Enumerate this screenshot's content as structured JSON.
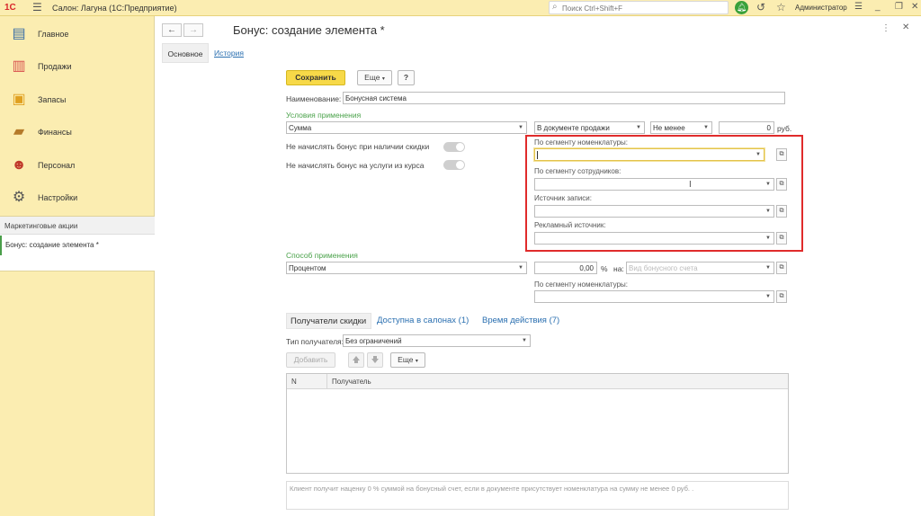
{
  "app": {
    "logo": "1С",
    "window_title": "Салон: Лагуна  (1С:Предприятие)",
    "search_placeholder": "Поиск Ctrl+Shift+F",
    "user": "Администратор"
  },
  "sidebar": {
    "items": [
      {
        "label": "Главное",
        "icon": "clipboard-icon",
        "color": "#3b6ea5"
      },
      {
        "label": "Продажи",
        "icon": "bar-chart-icon",
        "color": "#d9534f"
      },
      {
        "label": "Запасы",
        "icon": "inventory-icon",
        "color": "#e0a020"
      },
      {
        "label": "Финансы",
        "icon": "wallet-icon",
        "color": "#b47a2a"
      },
      {
        "label": "Персонал",
        "icon": "people-icon",
        "color": "#c0392b"
      },
      {
        "label": "Настройки",
        "icon": "gear-icon",
        "color": "#555555"
      }
    ],
    "section_header": "Маркетинговые акции",
    "open_window": "Бонус: создание элемента *"
  },
  "form": {
    "title": "Бонус: создание элемента *",
    "tabs": {
      "main": "Основное",
      "history": "История"
    },
    "save_label": "Сохранить",
    "more_label": "Еще",
    "help_label": "?",
    "name_label": "Наименование:",
    "name_value": "Бонусная система",
    "conditions_header": "Условия применения",
    "condition_basis": "Сумма",
    "condition_where": "В документе продажи",
    "condition_compare": "Не менее",
    "condition_amount": "0",
    "currency": "руб.",
    "no_bonus_discount": "Не начислять бонус при наличии скидки",
    "no_bonus_course": "Не начислять бонус на услуги из курса",
    "seg_nomenclature": "По сегменту номенклатуры:",
    "seg_employees": "По сегменту сотрудников:",
    "record_source": "Источник записи:",
    "ad_source": "Рекламный источник:",
    "method_header": "Способ применения",
    "method_value": "Процентом",
    "percent_value": "0,00",
    "percent_sign": "%",
    "on_label": "на:",
    "account_placeholder": "Вид бонусного счета",
    "method_seg_nomenclature": "По сегменту номенклатуры:",
    "subtabs": {
      "recipients": "Получатели скидки",
      "salons": "Доступна в салонах (1)",
      "time": "Время действия (7)"
    },
    "recipient_type_label": "Тип получателя:",
    "recipient_type_value": "Без ограничений",
    "add_label": "Добавить",
    "more_label2": "Еще",
    "grid_columns": [
      "N",
      "Получатель"
    ],
    "summary_text": "Клиент получит наценку 0 % суммой на бонусный счет, если в документе присутствует номенклатура на сумму не менее 0 руб. ."
  },
  "colors": {
    "accent_yellow": "#fbedb1",
    "save_button": "#f7d948",
    "green_label": "#4aa24a",
    "link_blue": "#2a6fb0",
    "highlight_red": "#e02b2b"
  }
}
